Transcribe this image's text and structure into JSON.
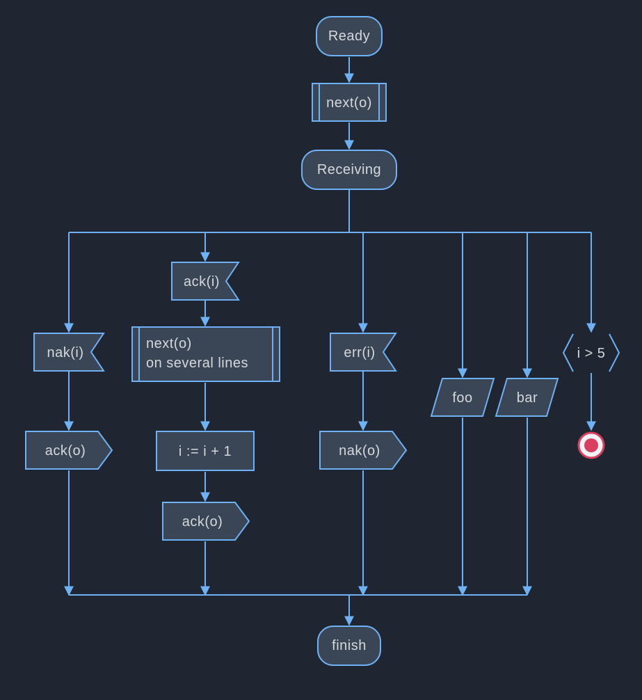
{
  "diagram": {
    "type": "flowchart",
    "colors": {
      "background": "#1f2631",
      "node_fill": "#3a4556",
      "node_stroke": "#6fb1f5",
      "edge": "#6fb1f5",
      "text": "#d5d8dd",
      "terminal_fill": "#d9405f",
      "terminal_ring": "#f2f3f4"
    },
    "nodes": {
      "ready": {
        "shape": "stadium",
        "label": "Ready"
      },
      "next_o_1": {
        "shape": "subroutine",
        "label": "next(o)"
      },
      "receiving": {
        "shape": "stadium",
        "label": "Receiving"
      },
      "nak_i": {
        "shape": "flag-in",
        "label": "nak(i)"
      },
      "ack_o_1": {
        "shape": "flag-out",
        "label": "ack(o)"
      },
      "ack_i": {
        "shape": "flag-in",
        "label": "ack(i)"
      },
      "next_o_2": {
        "shape": "subroutine",
        "label_lines": [
          "next(o)",
          "on several lines"
        ]
      },
      "assign": {
        "shape": "rect",
        "label": "i := i + 1"
      },
      "ack_o_2": {
        "shape": "flag-out",
        "label": "ack(o)"
      },
      "err_i": {
        "shape": "flag-in",
        "label": "err(i)"
      },
      "nak_o": {
        "shape": "flag-out",
        "label": "nak(o)"
      },
      "foo": {
        "shape": "parallelogram",
        "label": "foo"
      },
      "bar": {
        "shape": "parallelogram",
        "label": "bar"
      },
      "cond": {
        "shape": "angle",
        "label": "i > 5"
      },
      "terminal": {
        "shape": "end",
        "label": ""
      },
      "finish": {
        "shape": "stadium",
        "label": "finish"
      }
    },
    "edges": [
      [
        "ready",
        "next_o_1"
      ],
      [
        "next_o_1",
        "receiving"
      ],
      [
        "receiving",
        "nak_i"
      ],
      [
        "receiving",
        "ack_i"
      ],
      [
        "receiving",
        "err_i"
      ],
      [
        "receiving",
        "foo"
      ],
      [
        "receiving",
        "bar"
      ],
      [
        "receiving",
        "cond"
      ],
      [
        "nak_i",
        "ack_o_1"
      ],
      [
        "ack_i",
        "next_o_2"
      ],
      [
        "next_o_2",
        "assign"
      ],
      [
        "assign",
        "ack_o_2"
      ],
      [
        "err_i",
        "nak_o"
      ],
      [
        "cond",
        "terminal"
      ],
      [
        "ack_o_1",
        "finish"
      ],
      [
        "ack_o_2",
        "finish"
      ],
      [
        "nak_o",
        "finish"
      ],
      [
        "foo",
        "finish"
      ],
      [
        "bar",
        "finish"
      ]
    ]
  }
}
